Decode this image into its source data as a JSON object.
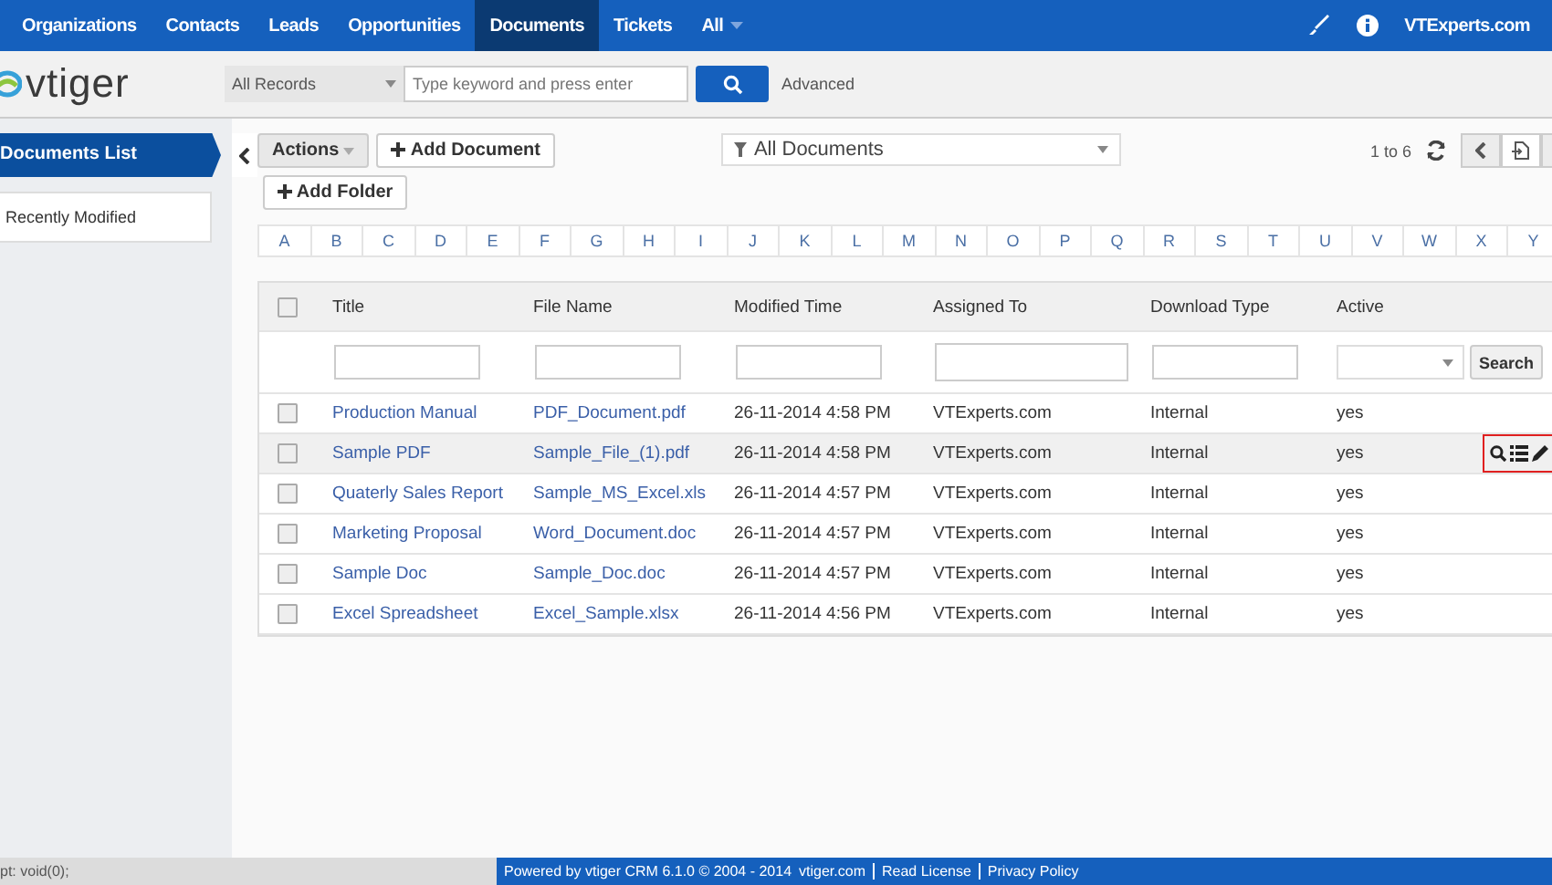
{
  "nav": {
    "items": [
      {
        "label": "Organizations",
        "selected": false
      },
      {
        "label": "Contacts",
        "selected": false
      },
      {
        "label": "Leads",
        "selected": false
      },
      {
        "label": "Opportunities",
        "selected": false
      },
      {
        "label": "Documents",
        "selected": true
      },
      {
        "label": "Tickets",
        "selected": false
      },
      {
        "label": "All",
        "selected": false
      }
    ],
    "user": "VTExperts.com"
  },
  "header": {
    "logo": "vtiger",
    "record_type": "All Records",
    "search": {
      "placeholder": "Type keyword and press enter"
    },
    "advanced": "Advanced"
  },
  "sidebar": {
    "items": [
      {
        "label": "Documents List",
        "selected": true
      },
      {
        "label": "Recently Modified",
        "selected": false
      }
    ]
  },
  "toolbar": {
    "actions": "Actions",
    "add_document": "Add Document",
    "add_folder": "Add Folder",
    "filter": "All Documents",
    "paging": "1 to 6"
  },
  "alphabet": [
    "A",
    "B",
    "C",
    "D",
    "E",
    "F",
    "G",
    "H",
    "I",
    "J",
    "K",
    "L",
    "M",
    "N",
    "O",
    "P",
    "Q",
    "R",
    "S",
    "T",
    "U",
    "V",
    "W",
    "X",
    "Y"
  ],
  "table": {
    "all_checked": false,
    "columns": [
      "Title",
      "File Name",
      "Modified Time",
      "Assigned To",
      "Download Type",
      "Active"
    ],
    "search_button": "Search",
    "rows": [
      {
        "checked": false,
        "highlighted": false,
        "cells": [
          "Production Manual",
          "PDF_Document.pdf",
          "26-11-2014 4:58 PM",
          "VTExperts.com",
          "Internal",
          "yes"
        ]
      },
      {
        "checked": false,
        "highlighted": true,
        "cells": [
          "Sample PDF",
          "Sample_File_(1).pdf",
          "26-11-2014 4:58 PM",
          "VTExperts.com",
          "Internal",
          "yes"
        ]
      },
      {
        "checked": false,
        "highlighted": false,
        "cells": [
          "Quaterly Sales Report",
          "Sample_MS_Excel.xls",
          "26-11-2014 4:57 PM",
          "VTExperts.com",
          "Internal",
          "yes"
        ]
      },
      {
        "checked": false,
        "highlighted": false,
        "cells": [
          "Marketing Proposal",
          "Word_Document.doc",
          "26-11-2014 4:57 PM",
          "VTExperts.com",
          "Internal",
          "yes"
        ]
      },
      {
        "checked": false,
        "highlighted": false,
        "cells": [
          "Sample Doc",
          "Sample_Doc.doc",
          "26-11-2014 4:57 PM",
          "VTExperts.com",
          "Internal",
          "yes"
        ]
      },
      {
        "checked": false,
        "highlighted": false,
        "cells": [
          "Excel Spreadsheet",
          "Excel_Sample.xlsx",
          "26-11-2014 4:56 PM",
          "VTExperts.com",
          "Internal",
          "yes"
        ]
      }
    ]
  },
  "status_bar": "pt: void(0);",
  "footer": {
    "powered": "Powered by vtiger CRM 6.1.0  © 2004 - 2014",
    "site": "vtiger.com",
    "license": "Read License",
    "privacy": "Privacy Policy"
  }
}
